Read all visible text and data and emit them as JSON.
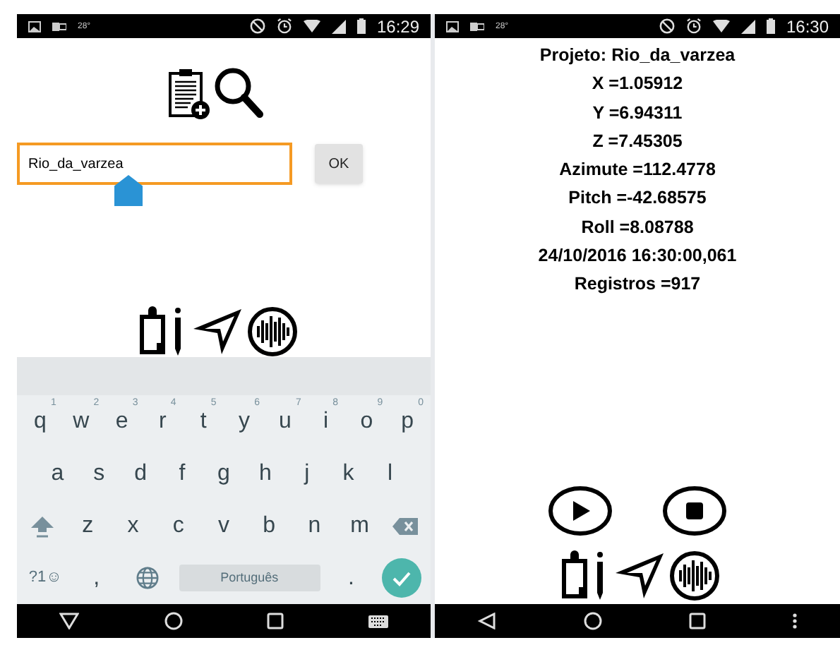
{
  "left_phone": {
    "status_bar": {
      "temperature": "28°",
      "time": "16:29"
    },
    "project_field": {
      "value": "Rio_da_varzea",
      "focused": true
    },
    "ok_button": "OK",
    "keyboard": {
      "rows": [
        {
          "keys": [
            {
              "label": "q",
              "hint": "1"
            },
            {
              "label": "w",
              "hint": "2"
            },
            {
              "label": "e",
              "hint": "3"
            },
            {
              "label": "r",
              "hint": "4"
            },
            {
              "label": "t",
              "hint": "5"
            },
            {
              "label": "y",
              "hint": "6"
            },
            {
              "label": "u",
              "hint": "7"
            },
            {
              "label": "i",
              "hint": "8"
            },
            {
              "label": "o",
              "hint": "9"
            },
            {
              "label": "p",
              "hint": "0"
            }
          ]
        },
        {
          "keys": [
            {
              "label": "a"
            },
            {
              "label": "s"
            },
            {
              "label": "d"
            },
            {
              "label": "f"
            },
            {
              "label": "g"
            },
            {
              "label": "h"
            },
            {
              "label": "j"
            },
            {
              "label": "k"
            },
            {
              "label": "l"
            }
          ]
        },
        {
          "keys": [
            {
              "kind": "shift"
            },
            {
              "label": "z"
            },
            {
              "label": "x"
            },
            {
              "label": "c"
            },
            {
              "label": "v"
            },
            {
              "label": "b"
            },
            {
              "label": "n"
            },
            {
              "label": "m"
            },
            {
              "kind": "backspace"
            }
          ]
        },
        {
          "keys": [
            {
              "kind": "symbols",
              "label": "?1☺"
            },
            {
              "label": ","
            },
            {
              "kind": "globe"
            },
            {
              "kind": "space",
              "label": "Português"
            },
            {
              "label": "."
            },
            {
              "kind": "enter"
            }
          ]
        }
      ]
    }
  },
  "right_phone": {
    "status_bar": {
      "temperature": "28°",
      "time": "16:30"
    },
    "readings": [
      "Projeto: Rio_da_varzea",
      "X =1.05912",
      "Y =6.94311",
      "Z =7.45305",
      "Azimute =112.4778",
      "Pitch =-42.68575",
      "Roll =8.08788",
      "24/10/2016 16:30:00,061",
      "Registros =917"
    ]
  }
}
